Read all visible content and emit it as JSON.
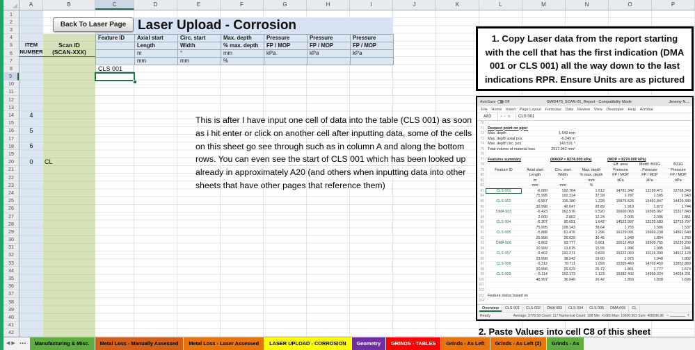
{
  "sheet": {
    "col_letters": [
      "A",
      "B",
      "C",
      "D",
      "E",
      "F",
      "G",
      "H",
      "I",
      "J",
      "K",
      "L",
      "M",
      "N",
      "O",
      "P"
    ],
    "row_count": 42,
    "toolbar": {
      "back_button": "Back To Laser Page",
      "title": "Laser Upload - Corrosion"
    },
    "headers": {
      "item_line1": "ITEM",
      "item_line2": "NUMBER",
      "scan_line1": "Scan ID",
      "scan_line2": "(SCAN-XXX)",
      "columns": [
        {
          "title": "Feature ID",
          "sub": "",
          "unit1": "",
          "unit2": ""
        },
        {
          "title": "Axial start",
          "sub": "Length",
          "unit1": "m",
          "unit2": "mm"
        },
        {
          "title": "Circ. start",
          "sub": "Width",
          "unit1": "°",
          "unit2": "mm"
        },
        {
          "title": "Max. depth",
          "sub": "% max. depth",
          "unit1": "mm",
          "unit2": "%"
        },
        {
          "title": "Pressure",
          "sub": "FP / MOP",
          "unit1": "kPa",
          "unit2": ""
        },
        {
          "title": "Pressure",
          "sub": "FP / MOP",
          "unit1": "kPa",
          "unit2": ""
        },
        {
          "title": "Pressure",
          "sub": "FP / MOP",
          "unit1": "kPa",
          "unit2": ""
        }
      ]
    },
    "cells": {
      "c8": "CLS 001",
      "a14": "4",
      "a16": "5",
      "a18": "6",
      "a20": "0",
      "b20": "CL"
    },
    "note": "This is after I have input one cell of data into the table (CLS 001) as soon as i hit enter or click on another cell after inputting data, some of the cells on this sheet go see through such as in column A and along the bottom rows. You can even see the start of CLS 001 which has been looked up already in approximately A20 (and others when inputting data into other sheets that have other pages that reference them)"
  },
  "instructions": {
    "step1": "1. Copy Laser data from the report starting with the cell that has the first indication (DMA 001 or CLS 001) all the way down to the last indications RPR. Ensure Units are as pictured",
    "step2": "2. Paste Values into cell C8 of this sheet"
  },
  "report": {
    "titlebar": {
      "autosave_label": "AutoSave",
      "autosave_state": "Off",
      "title": "GWD470_SCAN-01_Report - Compatibility Mode",
      "user": "Jeremy N…"
    },
    "ribbon_tabs": [
      "File",
      "Home",
      "Insert",
      "Page Layout",
      "Formulas",
      "Data",
      "Review",
      "View",
      "Developer",
      "Help",
      "Acrobat"
    ],
    "name_box": "A83",
    "fx_icons": "× ✓ fx",
    "formula_bar": "CLS 001",
    "rows": [
      {
        "n": "70",
        "c": [
          "",
          "",
          "",
          "",
          "",
          "",
          ""
        ]
      },
      {
        "n": "71",
        "c": [
          "Deepest point on pipe:",
          "",
          "",
          "",
          "",
          "",
          ""
        ],
        "b": 1
      },
      {
        "n": "72",
        "c": [
          "Max. depth",
          "",
          "1.642 mm",
          "",
          "",
          "",
          ""
        ]
      },
      {
        "n": "73",
        "c": [
          "Max. depth axial pos.",
          "",
          "-6.249 m",
          "",
          "",
          "",
          ""
        ]
      },
      {
        "n": "74",
        "c": [
          "Max. depth circ. pos.",
          "",
          "143.531 °",
          "",
          "",
          "",
          ""
        ]
      },
      {
        "n": "75",
        "c": [
          "Total volume of material loss",
          "",
          "2517.942 mm³",
          "",
          "",
          "",
          ""
        ]
      },
      {
        "n": "76",
        "c": [
          "",
          "",
          "",
          "",
          "",
          "",
          ""
        ]
      },
      {
        "n": "77",
        "c": [
          "Features summary",
          "",
          "(MAOP = 8274.000 kPa)",
          "",
          "(MOP = 8274.000 kPa)",
          "",
          ""
        ],
        "b": 1
      },
      {
        "n": "78",
        "c": [
          "",
          "",
          "",
          "",
          "Eff. area",
          "Modif. B31G",
          "B31G"
        ],
        "h": 1
      },
      {
        "n": "79",
        "c": [
          "Feature ID",
          "Axial start",
          "Circ. start",
          "Max. depth",
          "Pressure",
          "Pressure",
          "Pressure"
        ],
        "h": 1
      },
      {
        "n": "80",
        "c": [
          "",
          "Length",
          "Width",
          "% max. depth",
          "FP / MOP",
          "FP / MOP",
          "FP / MOP"
        ],
        "h": 1
      },
      {
        "n": "81",
        "c": [
          "",
          "m",
          "°",
          "mm",
          "kPa",
          "kPa",
          "kPa"
        ],
        "h": 1
      },
      {
        "n": "82",
        "c": [
          "",
          "mm",
          "mm",
          "%",
          "",
          "",
          ""
        ],
        "h": 1
      },
      {
        "n": "83",
        "c": [
          "CLS 001",
          "-6.680",
          "192.764",
          "1.612",
          "14781.342",
          "13199.471",
          "12768.349"
        ]
      },
      {
        "n": "84",
        "c": [
          "",
          "75.995",
          "192.214",
          "37.93",
          "1.787",
          "1.595",
          "1.543"
        ]
      },
      {
        "n": "85",
        "c": [
          "CLS 002",
          "-6.557",
          "116.180",
          "1.228",
          "15875.526",
          "15491.847",
          "14425.380"
        ]
      },
      {
        "n": "86",
        "c": [
          "",
          "30.998",
          "42.047",
          "28.89",
          "1.919",
          "1.872",
          "1.744"
        ]
      },
      {
        "n": "87",
        "c": [
          "DMA 003",
          "-6.423",
          "262.576",
          "0.520",
          "16600.063",
          "16595.067",
          "15317.843"
        ]
      },
      {
        "n": "88",
        "c": [
          "",
          "2.000",
          "2.002",
          "12.24",
          "2.006",
          "2.006",
          "1.851"
        ]
      },
      {
        "n": "89",
        "c": [
          "CLS 004",
          "-6.307",
          "90.651",
          "1.642",
          "14523.997",
          "13125.683",
          "12715.797"
        ]
      },
      {
        "n": "90",
        "c": [
          "",
          "75.995",
          "128.143",
          "38.64",
          "1.755",
          "1.586",
          "1.537"
        ]
      },
      {
        "n": "91",
        "c": [
          "CLS 005",
          "-5.888",
          "61.476",
          "1.296",
          "16129.091",
          "15669.238",
          "14561.640"
        ]
      },
      {
        "n": "92",
        "c": [
          "",
          "25.998",
          "26.029",
          "30.45",
          "1.949",
          "1.894",
          "1.760"
        ]
      },
      {
        "n": "93",
        "c": [
          "DMA 006",
          "-5.802",
          "93.777",
          "0.661",
          "16512.459",
          "16505.755",
          "15235.209"
        ]
      },
      {
        "n": "94",
        "c": [
          "",
          "10.999",
          "13.015",
          "15.55",
          "1.996",
          "1.995",
          "1.841"
        ]
      },
      {
        "n": "95",
        "c": [
          "CLS 007",
          "-5.402",
          "191.271",
          "0.833",
          "16322.060",
          "16116.390",
          "14912.128"
        ]
      },
      {
        "n": "96",
        "c": [
          "",
          "23.998",
          "38.042",
          "19.60",
          "1.973",
          "1.948",
          "1.802"
        ]
      },
      {
        "n": "97",
        "c": [
          "CLS 008",
          "-5.312",
          "79.711",
          "1.093",
          "15395.460",
          "14702.450",
          "13852.889"
        ]
      },
      {
        "n": "98",
        "c": [
          "",
          "20.998",
          "26.029",
          "25.72",
          "1.861",
          "1.777",
          "1.674"
        ]
      },
      {
        "n": "99",
        "c": [
          "CLS 009",
          "-5.114",
          "152.173",
          "1.123",
          "15382.402",
          "14959.024",
          "14034.201"
        ]
      },
      {
        "n": "100",
        "c": [
          "",
          "48.997",
          "36.040",
          "26.42",
          "1.859",
          "1.808",
          "1.696"
        ]
      },
      {
        "n": "101",
        "c": [
          "",
          "",
          "",
          "",
          "",
          "",
          ""
        ]
      },
      {
        "n": "102",
        "c": [
          "",
          "",
          "",
          "",
          "",
          "",
          ""
        ]
      },
      {
        "n": "103",
        "c": [
          "Feature status based on",
          "",
          "",
          "",
          "",
          "",
          ""
        ]
      },
      {
        "n": "104",
        "c": [
          "",
          "",
          "",
          "",
          "",
          "",
          ""
        ]
      }
    ],
    "sheet_tabs": [
      "Overview",
      "CLS 001",
      "CLS 002",
      "DMA 003",
      "CLS 004",
      "CLS 005",
      "DMA 006",
      "CL"
    ],
    "status": {
      "ready": "Ready",
      "stats": "Average: 3778.58   Count: 117   Numerical Count: 108   Min: -6.680   Max: 16600.063   Sum: 408096.96",
      "zoom_out": "−",
      "zoom_in": "+"
    }
  },
  "tabbar": {
    "nav_left": "◀",
    "nav_right": "▶",
    "more": "…"
  },
  "tabs": [
    {
      "label": "Manufacturing & Misc.",
      "bg": "#5FAD41",
      "fg": "#000000"
    },
    {
      "label": "Metal Loss - Manually Assessed",
      "bg": "#D2601A",
      "fg": "#000000"
    },
    {
      "label": "Metal Loss - Laser Assessed",
      "bg": "#E8740C",
      "fg": "#000000"
    },
    {
      "label": "LASER UPLOAD - CORROSION",
      "bg": "#FFFF00",
      "fg": "#000000",
      "active": true
    },
    {
      "label": "Geometry",
      "bg": "#7030A0",
      "fg": "#FFFFFF"
    },
    {
      "label": "GRINDS - TABLES",
      "bg": "#FF0000",
      "fg": "#FFFFFF"
    },
    {
      "label": "Grinds - As Left",
      "bg": "#E8740C",
      "fg": "#000000"
    },
    {
      "label": "Grinds - As Left (2)",
      "bg": "#E8740C",
      "fg": "#000000"
    },
    {
      "label": "Grinds - As",
      "bg": "#5FAD41",
      "fg": "#000000"
    }
  ]
}
